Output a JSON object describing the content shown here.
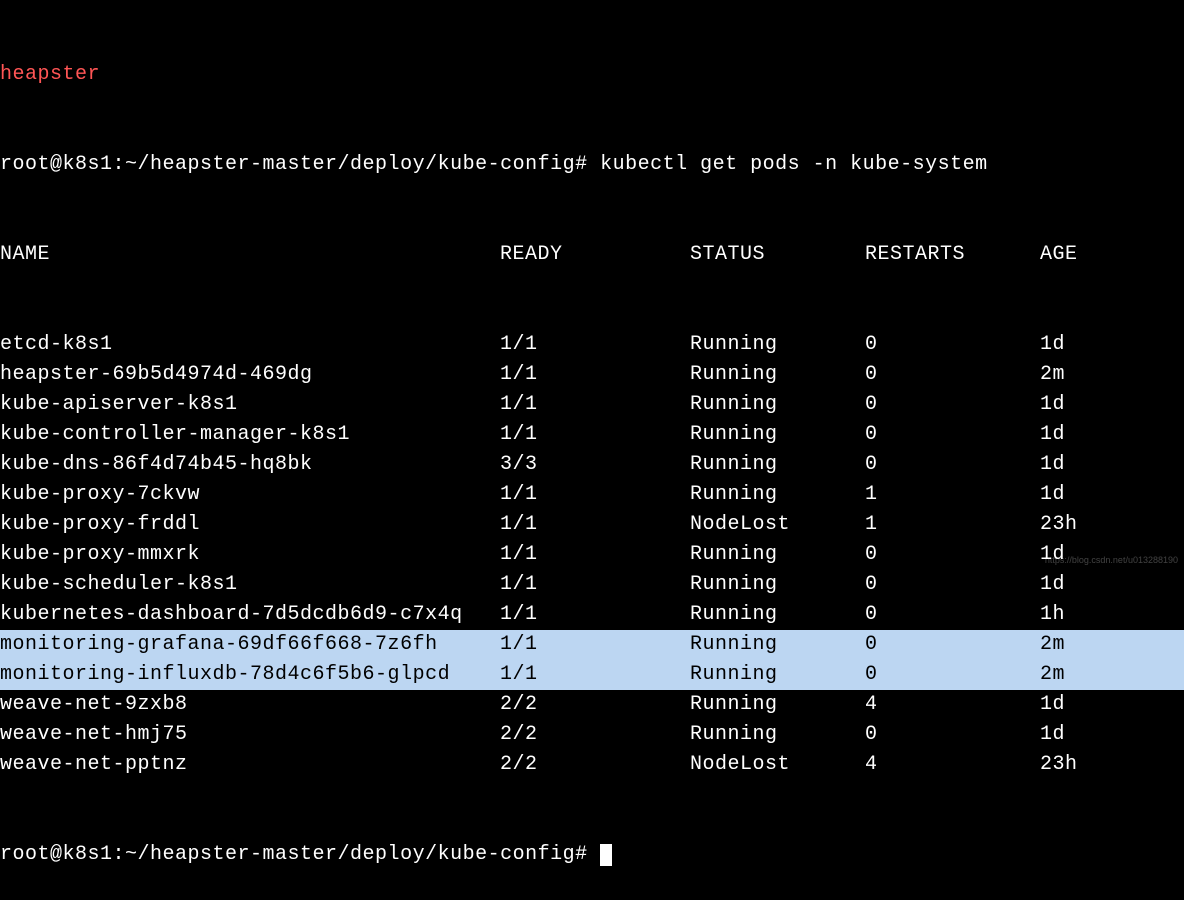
{
  "partial_line": {
    "name_frag": "heapster",
    "rest_frag": ""
  },
  "prompt1": "root@k8s1:~/heapster-master/deploy/kube-config#",
  "command": "kubectl get pods -n kube-system",
  "headers": {
    "name": "NAME",
    "ready": "READY",
    "status": "STATUS",
    "restarts": "RESTARTS",
    "age": "AGE"
  },
  "rows": [
    {
      "name": "etcd-k8s1",
      "ready": "1/1",
      "status": "Running",
      "restarts": "0",
      "age": "1d",
      "hl": false
    },
    {
      "name": "heapster-69b5d4974d-469dg",
      "ready": "1/1",
      "status": "Running",
      "restarts": "0",
      "age": "2m",
      "hl": false
    },
    {
      "name": "kube-apiserver-k8s1",
      "ready": "1/1",
      "status": "Running",
      "restarts": "0",
      "age": "1d",
      "hl": false
    },
    {
      "name": "kube-controller-manager-k8s1",
      "ready": "1/1",
      "status": "Running",
      "restarts": "0",
      "age": "1d",
      "hl": false
    },
    {
      "name": "kube-dns-86f4d74b45-hq8bk",
      "ready": "3/3",
      "status": "Running",
      "restarts": "0",
      "age": "1d",
      "hl": false
    },
    {
      "name": "kube-proxy-7ckvw",
      "ready": "1/1",
      "status": "Running",
      "restarts": "1",
      "age": "1d",
      "hl": false
    },
    {
      "name": "kube-proxy-frddl",
      "ready": "1/1",
      "status": "NodeLost",
      "restarts": "1",
      "age": "23h",
      "hl": false
    },
    {
      "name": "kube-proxy-mmxrk",
      "ready": "1/1",
      "status": "Running",
      "restarts": "0",
      "age": "1d",
      "hl": false
    },
    {
      "name": "kube-scheduler-k8s1",
      "ready": "1/1",
      "status": "Running",
      "restarts": "0",
      "age": "1d",
      "hl": false
    },
    {
      "name": "kubernetes-dashboard-7d5dcdb6d9-c7x4q",
      "ready": "1/1",
      "status": "Running",
      "restarts": "0",
      "age": "1h",
      "hl": false
    },
    {
      "name": "monitoring-grafana-69df66f668-7z6fh",
      "ready": "1/1",
      "status": "Running",
      "restarts": "0",
      "age": "2m",
      "hl": true
    },
    {
      "name": "monitoring-influxdb-78d4c6f5b6-glpcd",
      "ready": "1/1",
      "status": "Running",
      "restarts": "0",
      "age": "2m",
      "hl": true
    },
    {
      "name": "weave-net-9zxb8",
      "ready": "2/2",
      "status": "Running",
      "restarts": "4",
      "age": "1d",
      "hl": false
    },
    {
      "name": "weave-net-hmj75",
      "ready": "2/2",
      "status": "Running",
      "restarts": "0",
      "age": "1d",
      "hl": false
    },
    {
      "name": "weave-net-pptnz",
      "ready": "2/2",
      "status": "NodeLost",
      "restarts": "4",
      "age": "23h",
      "hl": false
    }
  ],
  "prompt2": "root@k8s1:~/heapster-master/deploy/kube-config#",
  "watermark": "https://blog.csdn.net/u013288190"
}
